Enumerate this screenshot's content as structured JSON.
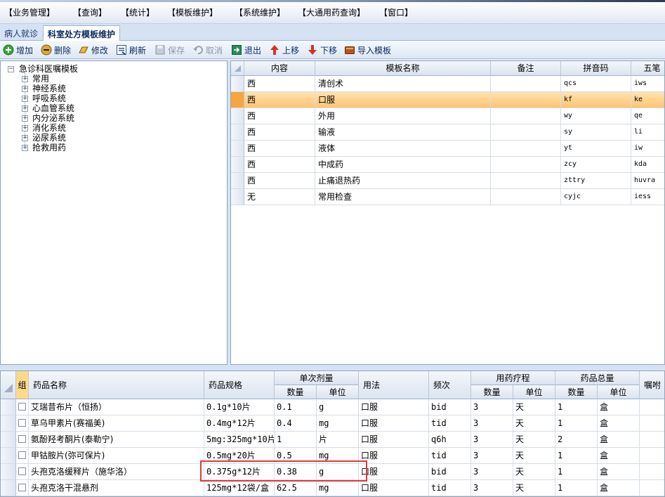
{
  "menubar": {
    "items": [
      "【业务管理】",
      "【查询】",
      "【统计】",
      "【模板维护】",
      "【系统维护】",
      "【大通用药查询】",
      "【窗口】"
    ]
  },
  "tabs": [
    {
      "label": "病人就诊",
      "active": false
    },
    {
      "label": "科室处方模板维护",
      "active": true
    }
  ],
  "toolbar": {
    "add": "增加",
    "delete": "删除",
    "edit": "修改",
    "refresh": "刷新",
    "save": "保存",
    "cancel": "取消",
    "exit": "退出",
    "up": "上移",
    "down": "下移",
    "import": "导入模板"
  },
  "tree": {
    "root": "急诊科医嘱模板",
    "children": [
      "常用",
      "神经系统",
      "呼吸系统",
      "心血管系统",
      "内分泌系统",
      "消化系统",
      "泌尿系统",
      "抢救用药"
    ]
  },
  "template_grid": {
    "headers": [
      "内容",
      "模板名称",
      "备注",
      "拼音码",
      "五笔"
    ],
    "rows": [
      {
        "type": "西",
        "name": "清创术",
        "note": "",
        "pinyin": "qcs",
        "wubi": "iws"
      },
      {
        "type": "西",
        "name": "口服",
        "note": "",
        "pinyin": "kf",
        "wubi": "ke"
      },
      {
        "type": "西",
        "name": "外用",
        "note": "",
        "pinyin": "wy",
        "wubi": "qe"
      },
      {
        "type": "西",
        "name": "输液",
        "note": "",
        "pinyin": "sy",
        "wubi": "li"
      },
      {
        "type": "西",
        "name": "液体",
        "note": "",
        "pinyin": "yt",
        "wubi": "iw"
      },
      {
        "type": "西",
        "name": "中成药",
        "note": "",
        "pinyin": "zcy",
        "wubi": "kda"
      },
      {
        "type": "西",
        "name": "止痛退热药",
        "note": "",
        "pinyin": "zttry",
        "wubi": "huvra"
      },
      {
        "type": "无",
        "name": "常用检查",
        "note": "",
        "pinyin": "cyjc",
        "wubi": "iess"
      }
    ],
    "selected_index": 1
  },
  "drug_grid": {
    "headers": {
      "group": "组",
      "name": "药品名称",
      "spec": "药品规格",
      "dose": "单次剂量",
      "dose_qty": "数量",
      "dose_unit": "单位",
      "usage": "用法",
      "freq": "频次",
      "course": "用药疗程",
      "course_qty": "数量",
      "course_unit": "单位",
      "total": "药品总量",
      "total_qty": "数量",
      "total_unit": "单位",
      "advice": "嘱咐"
    },
    "rows": [
      {
        "name": "艾瑞昔布片（恒扬）",
        "spec": "0.1g*10片",
        "dose_qty": "0.1",
        "dose_unit": "g",
        "usage": "口服",
        "freq": "bid",
        "course_qty": "3",
        "course_unit": "天",
        "total_qty": "1",
        "total_unit": "盒"
      },
      {
        "name": "草乌甲素片(赛福美)",
        "spec": "0.4mg*12片",
        "dose_qty": "0.4",
        "dose_unit": "mg",
        "usage": "口服",
        "freq": "tid",
        "course_qty": "3",
        "course_unit": "天",
        "total_qty": "1",
        "total_unit": "盒"
      },
      {
        "name": "氨酚羟考酮片(泰勒宁)",
        "spec": "5mg:325mg*10片",
        "dose_qty": "1",
        "dose_unit": "片",
        "usage": "口服",
        "freq": "q6h",
        "course_qty": "3",
        "course_unit": "天",
        "total_qty": "2",
        "total_unit": "盒"
      },
      {
        "name": "甲钴胺片(弥可保片)",
        "spec": "0.5mg*20片",
        "dose_qty": "0.5",
        "dose_unit": "mg",
        "usage": "口服",
        "freq": "tid",
        "course_qty": "3",
        "course_unit": "天",
        "total_qty": "1",
        "total_unit": "盒"
      },
      {
        "name": "头孢克洛缓释片（施华洛）",
        "spec": "0.375g*12片",
        "dose_qty": "0.38",
        "dose_unit": "g",
        "usage": "口服",
        "freq": "bid",
        "course_qty": "3",
        "course_unit": "天",
        "total_qty": "1",
        "total_unit": "盒"
      },
      {
        "name": "头孢克洛干混悬剂",
        "spec": "125mg*12袋/盒",
        "dose_qty": "62.5",
        "dose_unit": "mg",
        "usage": "口服",
        "freq": "tid",
        "course_qty": "3",
        "course_unit": "天",
        "total_qty": "1",
        "total_unit": "盒"
      }
    ]
  },
  "colors": {
    "selection": "#ffc36e",
    "highlight_box": "#e0393f",
    "accent": "#0d2b63"
  }
}
